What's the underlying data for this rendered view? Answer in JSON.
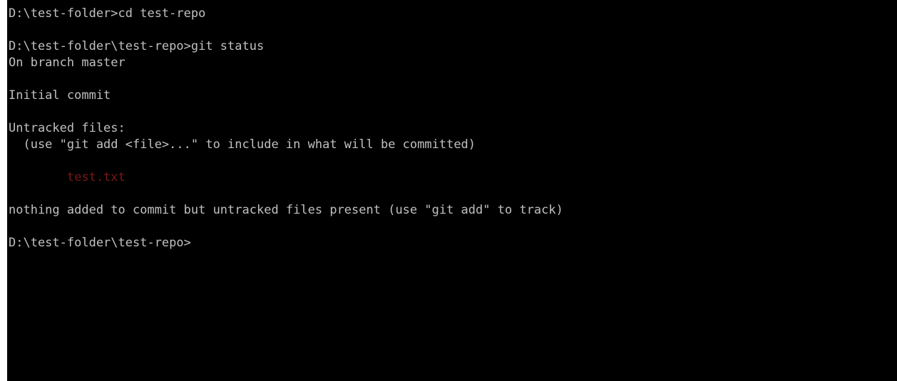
{
  "terminal": {
    "lines": {
      "cmd_cd": "D:\\test-folder>cd test-repo",
      "cmd_status": "D:\\test-folder\\test-repo>git status",
      "on_branch": "On branch master",
      "initial_commit": "Initial commit",
      "untracked_header": "Untracked files:",
      "untracked_hint": "  (use \"git add <file>...\" to include in what will be committed)",
      "untracked_file": "        test.txt",
      "summary": "nothing added to commit but untracked files present (use \"git add\" to track)",
      "prompt": "D:\\test-folder\\test-repo>"
    },
    "colors": {
      "background": "#000000",
      "text": "#c0c0c0",
      "untracked_file": "#7a1717"
    }
  }
}
